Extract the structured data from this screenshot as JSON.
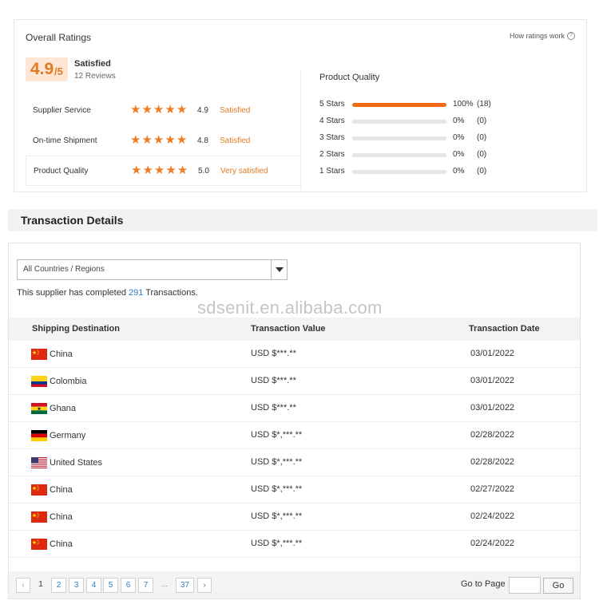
{
  "ratings": {
    "title": "Overall Ratings",
    "how_link": "How ratings work",
    "score_main": "4.9",
    "score_suffix": "/5",
    "satisfaction": "Satisfied",
    "reviews": "12 Reviews",
    "sub_ratings": [
      {
        "label": "Supplier Service",
        "stars": 5,
        "score": "4.9",
        "desc": "Satisfied"
      },
      {
        "label": "On-time Shipment",
        "stars": 5,
        "score": "4.8",
        "desc": "Satisfied"
      },
      {
        "label": "Product Quality",
        "stars": 5,
        "score": "5.0",
        "desc": "Very satisfied"
      }
    ],
    "product_quality": {
      "title": "Product Quality",
      "rows": [
        {
          "label": "5 Stars",
          "percent": 100,
          "pct_text": "100%",
          "count": "(18)"
        },
        {
          "label": "4 Stars",
          "percent": 0,
          "pct_text": "0%",
          "count": "(0)"
        },
        {
          "label": "3 Stars",
          "percent": 0,
          "pct_text": "0%",
          "count": "(0)"
        },
        {
          "label": "2 Stars",
          "percent": 0,
          "pct_text": "0%",
          "count": "(0)"
        },
        {
          "label": "1 Stars",
          "percent": 0,
          "pct_text": "0%",
          "count": "(0)"
        }
      ]
    },
    "accent_color": "#f26b10"
  },
  "transactions": {
    "title": "Transaction Details",
    "region_select": "All Countries / Regions",
    "completed_prefix": "This supplier has completed",
    "completed_count": "291",
    "completed_suffix": "Transactions.",
    "watermark": "sdsenit.en.alibaba.com",
    "columns": [
      "Shipping Destination",
      "Transaction Value",
      "Transaction Date"
    ],
    "rows": [
      {
        "flag": "china",
        "country": "China",
        "value": "USD $***.**",
        "date": "03/01/2022"
      },
      {
        "flag": "colombia",
        "country": "Colombia",
        "value": "USD $***.**",
        "date": "03/01/2022"
      },
      {
        "flag": "ghana",
        "country": "Ghana",
        "value": "USD $***.**",
        "date": "03/01/2022"
      },
      {
        "flag": "germany",
        "country": "Germany",
        "value": "USD $*,***.**",
        "date": "02/28/2022"
      },
      {
        "flag": "usa",
        "country": "United States",
        "value": "USD $*,***.**",
        "date": "02/28/2022"
      },
      {
        "flag": "china",
        "country": "China",
        "value": "USD $*,***.**",
        "date": "02/27/2022"
      },
      {
        "flag": "china",
        "country": "China",
        "value": "USD $*,***.**",
        "date": "02/24/2022"
      },
      {
        "flag": "china",
        "country": "China",
        "value": "USD $*,***.**",
        "date": "02/24/2022"
      }
    ],
    "pagination": {
      "prev": "‹",
      "current": "1",
      "pages": [
        "2",
        "3",
        "4",
        "5",
        "6",
        "7"
      ],
      "ellipsis": "...",
      "last": "37",
      "next": "›",
      "goto_label": "Go to Page",
      "go_button": "Go"
    }
  }
}
